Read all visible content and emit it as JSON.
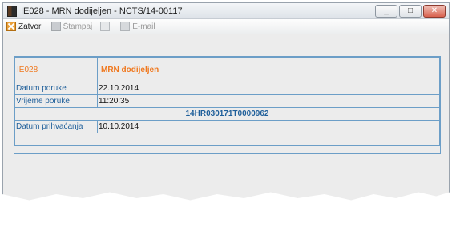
{
  "window": {
    "title": "IE028 - MRN dodijeljen - NCTS/14-00117",
    "buttons": {
      "minimize": "_",
      "maximize": "□",
      "close": "✕"
    }
  },
  "toolbar": {
    "close_label": "Zatvori",
    "print_label": "Štampaj",
    "email_label": "E-mail"
  },
  "document": {
    "code": "IE028",
    "title": "MRN dodijeljen",
    "rows": [
      {
        "label": "Datum poruke",
        "value": "22.10.2014"
      },
      {
        "label": "Vrijeme poruke",
        "value": "11:20:35"
      }
    ],
    "mrn": "14HR030171T0000962",
    "acceptance": {
      "label": "Datum prihvaćanja",
      "value": "10.10.2014"
    }
  }
}
